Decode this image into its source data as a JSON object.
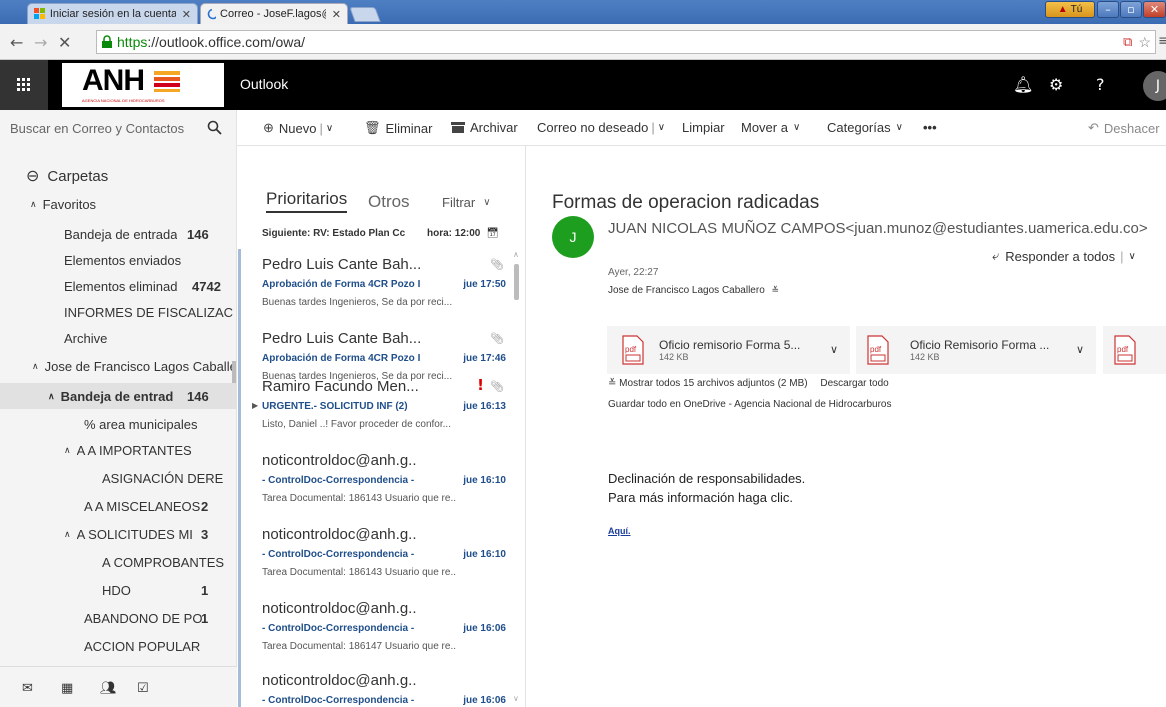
{
  "browser": {
    "tabs": [
      {
        "title": "Iniciar sesión en la cuenta",
        "active": false
      },
      {
        "title": "Correo - JoseF.lagos@anh.g",
        "active": true
      }
    ],
    "user_badge": "Tú",
    "url_https": "https",
    "url_rest": "://outlook.office.com/owa/"
  },
  "app": {
    "logo_text": "ANH",
    "logo_subtext": "AGENCIA NACIONAL DE HIDROCARBUROS",
    "title": "Outlook",
    "avatar_initial": "J"
  },
  "search": {
    "placeholder": "Buscar en Correo y Contactos"
  },
  "toolbar": {
    "new": "Nuevo",
    "delete": "Eliminar",
    "archive": "Archivar",
    "junk": "Correo no deseado",
    "sweep": "Limpiar",
    "move": "Mover a",
    "categories": "Categorías",
    "more": "•••",
    "undo": "Deshacer"
  },
  "folders": {
    "header": "Carpetas",
    "favorites_label": "Favoritos",
    "items": [
      {
        "label": "Bandeja de entrada",
        "count": "146"
      },
      {
        "label": "Elementos enviados",
        "count": ""
      },
      {
        "label": "Elementos eliminad",
        "count": "4742"
      },
      {
        "label": "INFORMES DE FISCALIZAC",
        "count": ""
      },
      {
        "label": "Archive",
        "count": ""
      },
      {
        "label": "Jose de Francisco Lagos Caballero",
        "count": ""
      },
      {
        "label": "Bandeja de entrad",
        "count": "146"
      },
      {
        "label": "% area municipales",
        "count": ""
      },
      {
        "label": "A A IMPORTANTES",
        "count": ""
      },
      {
        "label": "ASIGNACIÓN DERE",
        "count": ""
      },
      {
        "label": "A A MISCELANEOS",
        "count": "2"
      },
      {
        "label": "A SOLICITUDES MISI",
        "count": "3"
      },
      {
        "label": "A COMPROBANTES",
        "count": ""
      },
      {
        "label": "HDO",
        "count": "1"
      },
      {
        "label": "ABANDONO DE PO",
        "count": "1"
      },
      {
        "label": "ACCION POPULAR",
        "count": ""
      }
    ]
  },
  "list": {
    "tab_focused": "Prioritarios",
    "tab_other": "Otros",
    "filter": "Filtrar",
    "next_label": "Siguiente: RV: Estado Plan Cc",
    "next_time": "hora: 12:00",
    "messages": [
      {
        "sender": "Pedro Luis Cante Bah...",
        "subject": "Aprobación de Forma 4CR Pozo I",
        "time": "jue 17:50",
        "preview": "Buenas tardes Ingenieros,  Se da por reci..."
      },
      {
        "sender": "Pedro Luis Cante Bah...",
        "subject": "Aprobación de Forma 4CR Pozo I",
        "time": "jue 17:46",
        "preview": "Buenas tardes Ingenieros,  Se da por reci..."
      },
      {
        "sender": "Ramiro Facundo Men...",
        "subject": "URGENTE.- SOLICITUD INF   (2)",
        "time": "jue 16:13",
        "preview": "Listo, Daniel ..! Favor proceder de confor..."
      },
      {
        "sender": "noticontroldoc@anh.g..",
        "subject": "- ControlDoc-Correspondencia -",
        "time": "jue 16:10",
        "preview": "Tarea Documental: 186143  Usuario que re.."
      },
      {
        "sender": "noticontroldoc@anh.g..",
        "subject": "- ControlDoc-Correspondencia -",
        "time": "jue 16:10",
        "preview": "Tarea Documental: 186143  Usuario que re.."
      },
      {
        "sender": "noticontroldoc@anh.g..",
        "subject": "- ControlDoc-Correspondencia -",
        "time": "jue 16:06",
        "preview": "Tarea Documental: 186147  Usuario que re.."
      },
      {
        "sender": "noticontroldoc@anh.g..",
        "subject": "- ControlDoc-Correspondencia -",
        "time": "jue 16:06",
        "preview": ""
      }
    ]
  },
  "reading": {
    "subject": "Formas de operacion radicadas",
    "sender_initial": "J",
    "sender": "JUAN NICOLAS MUÑOZ CAMPOS<juan.munoz@estudiantes.uamerica.edu.co>",
    "reply_all": "Responder a todos",
    "date": "Ayer, 22:27",
    "recipient": "Jose de Francisco Lagos Caballero",
    "attachments": [
      {
        "name": "Oficio remisorio Forma 5...",
        "size": "142 KB"
      },
      {
        "name": "Oficio Remisorio Forma ...",
        "size": "142 KB"
      }
    ],
    "show_all": "Mostrar todos 15 archivos adjuntos (2 MB)",
    "download_all": "Descargar todo",
    "save_onedrive": "Guardar todo en OneDrive - Agencia Nacional de Hidrocarburos",
    "body_line1": "Declinación de responsabilidades.",
    "body_line2": "Para más información haga clic.",
    "link": "Aquí."
  },
  "colors": {
    "accent": "#0072c6",
    "avatar_green": "#1e9e1e",
    "header_bg": "#000000"
  }
}
